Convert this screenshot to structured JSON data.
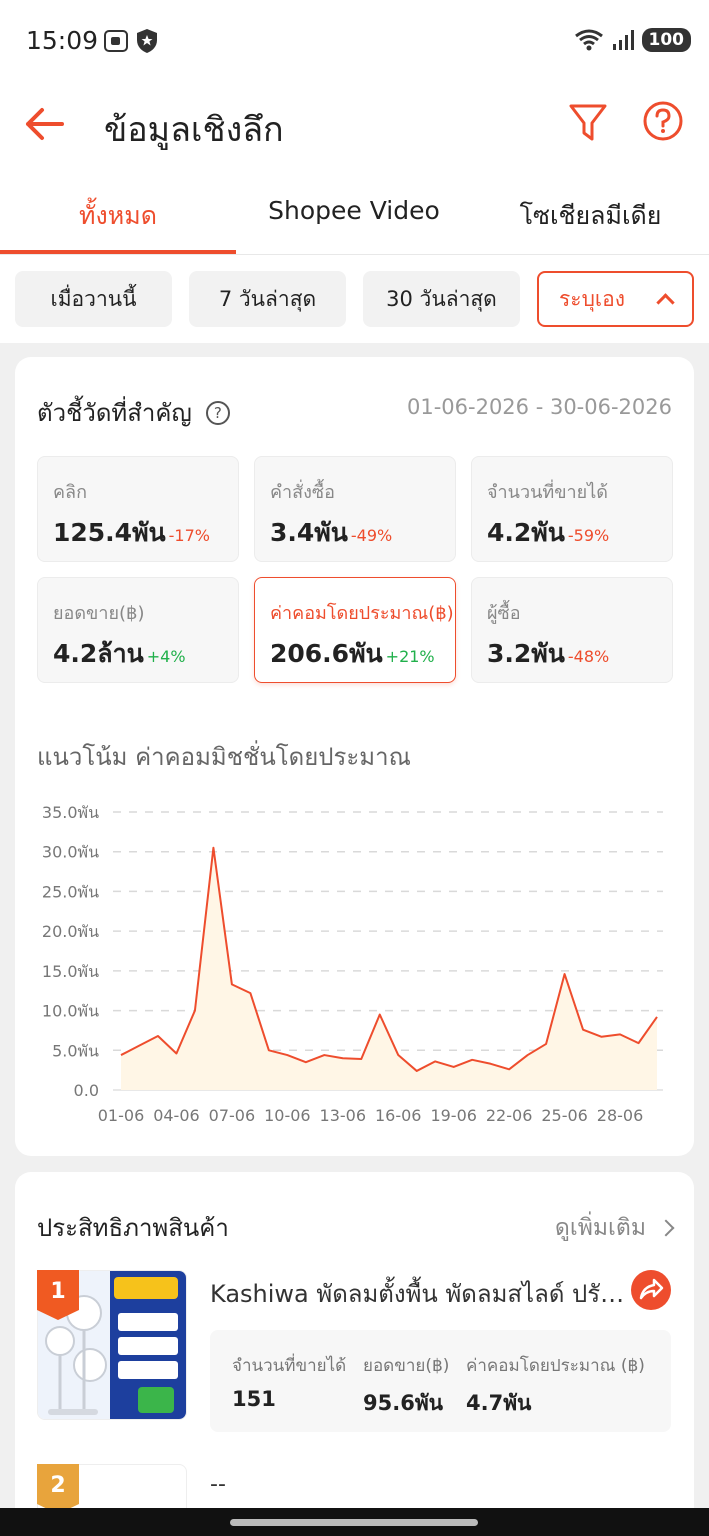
{
  "status_bar": {
    "time": "15:09",
    "battery": "100"
  },
  "header": {
    "title": "ข้อมูลเชิงลึก"
  },
  "tabs": [
    {
      "label": "ทั้งหมด",
      "active": true
    },
    {
      "label": "Shopee Video",
      "active": false
    },
    {
      "label": "โซเชียลมีเดีย",
      "active": false
    }
  ],
  "date_ranges": [
    {
      "label": "เมื่อวานนี้",
      "active": false
    },
    {
      "label": "7 วันล่าสุด",
      "active": false
    },
    {
      "label": "30 วันล่าสุด",
      "active": false
    },
    {
      "label": "ระบุเอง",
      "active": true
    }
  ],
  "metrics_section": {
    "title": "ตัวชี้วัดที่สำคัญ",
    "date_range": "01-06-2026 - 30-06-2026",
    "metrics": [
      {
        "label": "คลิก",
        "value": "125.4พัน",
        "delta": "-17%",
        "trend": "neg"
      },
      {
        "label": "คำสั่งซื้อ",
        "value": "3.4พัน",
        "delta": "-49%",
        "trend": "neg"
      },
      {
        "label": "จำนวนที่ขายได้",
        "value": "4.2พัน",
        "delta": "-59%",
        "trend": "neg"
      },
      {
        "label": "ยอดขาย(฿)",
        "value": "4.2ล้าน",
        "delta": "+4%",
        "trend": "pos"
      },
      {
        "label": "ค่าคอมโดยประมาณ(฿)",
        "value": "206.6พัน",
        "delta": "+21%",
        "trend": "pos",
        "selected": true
      },
      {
        "label": "ผู้ซื้อ",
        "value": "3.2พัน",
        "delta": "-48%",
        "trend": "neg"
      }
    ]
  },
  "trend_title": "แนวโน้ม ค่าคอมมิชชั่นโดยประมาณ",
  "chart_data": {
    "type": "area",
    "title": "แนวโน้ม ค่าคอมมิชชั่นโดยประมาณ",
    "x": [
      "01-06",
      "02-06",
      "03-06",
      "04-06",
      "05-06",
      "06-06",
      "07-06",
      "08-06",
      "09-06",
      "10-06",
      "11-06",
      "12-06",
      "13-06",
      "14-06",
      "15-06",
      "16-06",
      "17-06",
      "18-06",
      "19-06",
      "20-06",
      "21-06",
      "22-06",
      "23-06",
      "24-06",
      "25-06",
      "26-06",
      "27-06",
      "28-06",
      "29-06",
      "30-06"
    ],
    "tick_labels": [
      "01-06",
      "04-06",
      "07-06",
      "10-06",
      "13-06",
      "16-06",
      "19-06",
      "22-06",
      "25-06",
      "28-06"
    ],
    "y_tick_labels": [
      "0.0",
      "5.0พัน",
      "10.0พัน",
      "15.0พัน",
      "20.0พัน",
      "25.0พัน",
      "30.0พัน",
      "35.0พัน"
    ],
    "values": [
      4.4,
      5.6,
      6.8,
      4.6,
      10.0,
      30.5,
      13.3,
      12.2,
      5.0,
      4.4,
      3.5,
      4.4,
      4.0,
      3.9,
      9.5,
      4.4,
      2.4,
      3.6,
      2.9,
      3.8,
      3.3,
      2.6,
      4.4,
      5.8,
      14.6,
      7.6,
      6.7,
      7.0,
      5.9,
      9.2
    ],
    "ylim": [
      0,
      35
    ],
    "grid": true,
    "colors": {
      "line": "#ee4d2d",
      "fill": "#fff6e6",
      "grid": "#d9d9d9"
    }
  },
  "products_section": {
    "title": "ประสิทธิภาพสินค้า",
    "see_more": "ดูเพิ่มเติม",
    "products": [
      {
        "rank": "1",
        "name": "Kashiwa พัดลมตั้งพื้น พัดลมสไลด์ ปรับระดับ",
        "stats": [
          {
            "label": "จำนวนที่ขายได้",
            "value": "151"
          },
          {
            "label": "ยอดขาย(฿)",
            "value": "95.6พัน"
          },
          {
            "label": "ค่าคอมโดยประมาณ (฿)",
            "value": "4.7พัน"
          }
        ]
      },
      {
        "rank": "2",
        "name": "--"
      }
    ]
  },
  "colors": {
    "accent": "#ee4d2d",
    "positive": "#21b04b",
    "rank2": "#e8a43c"
  }
}
